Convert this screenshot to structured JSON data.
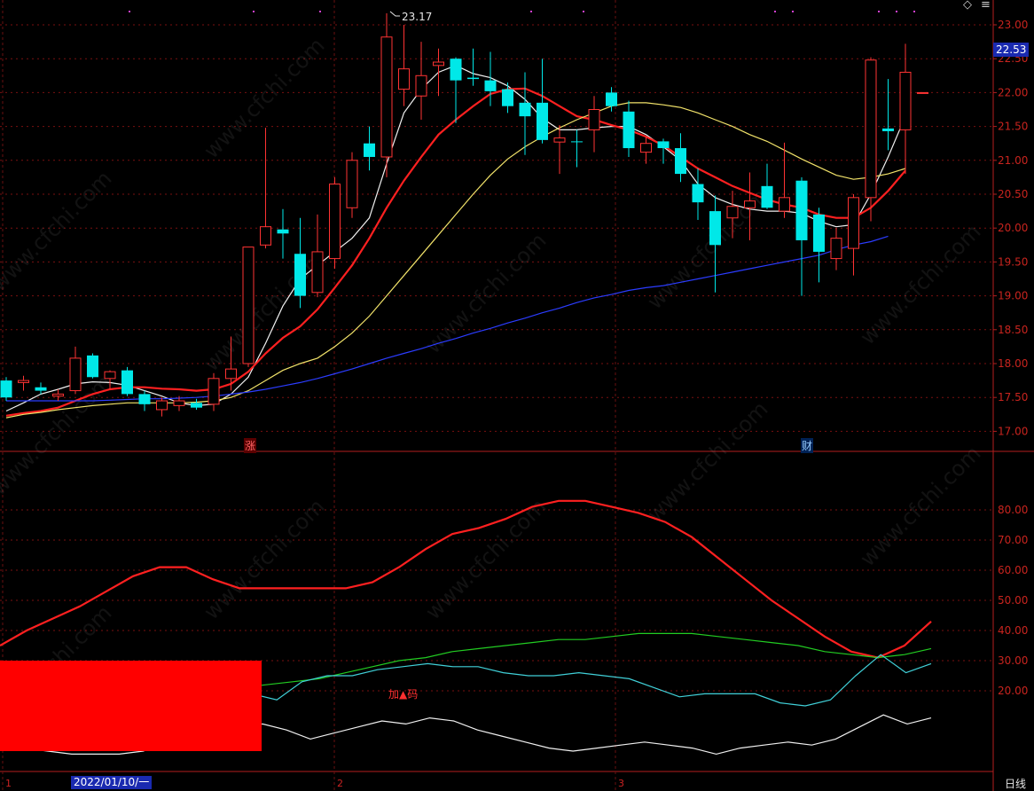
{
  "chart_data": [
    {
      "type": "candlestick",
      "period_label": "日线",
      "date_label": "2022/01/10/一",
      "month_labels": [
        "1",
        "2",
        "3"
      ],
      "price_badge": "22.53",
      "high_label": "23.17",
      "yticks": [
        17.0,
        17.5,
        18.0,
        18.5,
        19.0,
        19.5,
        20.0,
        20.5,
        21.0,
        21.5,
        22.0,
        22.5,
        23.0
      ],
      "ylim": [
        16.7,
        23.35
      ],
      "markers": [
        {
          "index": 14,
          "text": "涨"
        },
        {
          "index": 46,
          "text": "财"
        }
      ],
      "candles": [
        {
          "o": 17.75,
          "h": 17.8,
          "l": 17.45,
          "c": 17.5
        },
        {
          "o": 17.72,
          "h": 17.82,
          "l": 17.6,
          "c": 17.75
        },
        {
          "o": 17.65,
          "h": 17.72,
          "l": 17.55,
          "c": 17.6
        },
        {
          "o": 17.52,
          "h": 17.62,
          "l": 17.45,
          "c": 17.55
        },
        {
          "o": 17.6,
          "h": 18.25,
          "l": 17.55,
          "c": 18.08
        },
        {
          "o": 18.12,
          "h": 18.15,
          "l": 17.78,
          "c": 17.8
        },
        {
          "o": 17.78,
          "h": 17.9,
          "l": 17.62,
          "c": 17.88
        },
        {
          "o": 17.9,
          "h": 17.95,
          "l": 17.52,
          "c": 17.55
        },
        {
          "o": 17.55,
          "h": 17.6,
          "l": 17.3,
          "c": 17.4
        },
        {
          "o": 17.32,
          "h": 17.5,
          "l": 17.22,
          "c": 17.45
        },
        {
          "o": 17.38,
          "h": 17.52,
          "l": 17.3,
          "c": 17.45
        },
        {
          "o": 17.42,
          "h": 17.48,
          "l": 17.32,
          "c": 17.35
        },
        {
          "o": 17.4,
          "h": 17.86,
          "l": 17.3,
          "c": 17.78
        },
        {
          "o": 17.78,
          "h": 18.4,
          "l": 17.6,
          "c": 17.92
        },
        {
          "o": 18.0,
          "h": 18.55,
          "l": 17.95,
          "c": 19.72
        },
        {
          "o": 19.75,
          "h": 21.48,
          "l": 19.7,
          "c": 20.02
        },
        {
          "o": 19.98,
          "h": 20.28,
          "l": 19.55,
          "c": 19.92
        },
        {
          "o": 19.62,
          "h": 20.15,
          "l": 18.82,
          "c": 19.0
        },
        {
          "o": 19.05,
          "h": 20.2,
          "l": 18.98,
          "c": 19.65
        },
        {
          "o": 19.55,
          "h": 20.75,
          "l": 19.4,
          "c": 20.65
        },
        {
          "o": 20.3,
          "h": 21.12,
          "l": 20.15,
          "c": 21.0
        },
        {
          "o": 21.25,
          "h": 21.5,
          "l": 20.85,
          "c": 21.05
        },
        {
          "o": 21.05,
          "h": 23.17,
          "l": 20.75,
          "c": 22.82
        },
        {
          "o": 22.05,
          "h": 23.0,
          "l": 21.8,
          "c": 22.35
        },
        {
          "o": 21.95,
          "h": 22.75,
          "l": 21.6,
          "c": 22.25
        },
        {
          "o": 22.4,
          "h": 22.65,
          "l": 21.95,
          "c": 22.45
        },
        {
          "o": 22.5,
          "h": 22.52,
          "l": 21.55,
          "c": 22.18
        },
        {
          "o": 22.22,
          "h": 22.65,
          "l": 22.1,
          "c": 22.2
        },
        {
          "o": 22.18,
          "h": 22.6,
          "l": 21.8,
          "c": 22.02
        },
        {
          "o": 22.05,
          "h": 22.15,
          "l": 21.7,
          "c": 21.8
        },
        {
          "o": 21.85,
          "h": 22.3,
          "l": 21.08,
          "c": 21.65
        },
        {
          "o": 21.85,
          "h": 22.5,
          "l": 21.25,
          "c": 21.3
        },
        {
          "o": 21.27,
          "h": 21.52,
          "l": 20.8,
          "c": 21.33
        },
        {
          "o": 21.28,
          "h": 21.45,
          "l": 20.9,
          "c": 21.27
        },
        {
          "o": 21.45,
          "h": 21.95,
          "l": 21.12,
          "c": 21.75
        },
        {
          "o": 22.0,
          "h": 22.08,
          "l": 21.72,
          "c": 21.8
        },
        {
          "o": 21.72,
          "h": 21.88,
          "l": 21.05,
          "c": 21.18
        },
        {
          "o": 21.12,
          "h": 21.35,
          "l": 20.95,
          "c": 21.25
        },
        {
          "o": 21.28,
          "h": 21.32,
          "l": 20.95,
          "c": 21.18
        },
        {
          "o": 21.18,
          "h": 21.4,
          "l": 20.68,
          "c": 20.8
        },
        {
          "o": 20.65,
          "h": 20.88,
          "l": 20.12,
          "c": 20.38
        },
        {
          "o": 20.25,
          "h": 20.48,
          "l": 19.05,
          "c": 19.75
        },
        {
          "o": 20.15,
          "h": 20.55,
          "l": 19.85,
          "c": 20.32
        },
        {
          "o": 20.3,
          "h": 20.82,
          "l": 19.82,
          "c": 20.4
        },
        {
          "o": 20.62,
          "h": 20.95,
          "l": 20.28,
          "c": 20.3
        },
        {
          "o": 20.25,
          "h": 21.26,
          "l": 20.15,
          "c": 20.45
        },
        {
          "o": 20.7,
          "h": 20.75,
          "l": 19.0,
          "c": 19.82
        },
        {
          "o": 20.2,
          "h": 20.3,
          "l": 19.2,
          "c": 19.65
        },
        {
          "o": 19.55,
          "h": 20.0,
          "l": 19.38,
          "c": 19.85
        },
        {
          "o": 19.7,
          "h": 20.5,
          "l": 19.3,
          "c": 20.45
        },
        {
          "o": 20.45,
          "h": 22.52,
          "l": 20.1,
          "c": 22.48
        },
        {
          "o": 21.47,
          "h": 22.2,
          "l": 21.15,
          "c": 21.43
        },
        {
          "o": 21.45,
          "h": 22.72,
          "l": 20.8,
          "c": 22.3
        },
        {
          "o": 22.0,
          "h": 22.0,
          "l": 22.0,
          "c": 22.0
        }
      ],
      "ma_lines": [
        {
          "name": "ma-white",
          "color": "#f0f0f0",
          "values": [
            17.3,
            17.42,
            17.55,
            17.62,
            17.7,
            17.73,
            17.72,
            17.68,
            17.6,
            17.52,
            17.42,
            17.38,
            17.4,
            17.55,
            17.8,
            18.3,
            18.85,
            19.25,
            19.45,
            19.65,
            19.85,
            20.15,
            20.95,
            21.7,
            22.05,
            22.3,
            22.4,
            22.28,
            22.22,
            22.1,
            21.9,
            21.62,
            21.45,
            21.45,
            21.48,
            21.5,
            21.5,
            21.38,
            21.2,
            21.0,
            20.65,
            20.45,
            20.35,
            20.28,
            20.25,
            20.25,
            20.22,
            20.1,
            20.02,
            20.05,
            20.5,
            21.05,
            21.65
          ]
        },
        {
          "name": "ma-red",
          "color": "#ff2020",
          "values": [
            17.23,
            17.27,
            17.3,
            17.35,
            17.45,
            17.55,
            17.62,
            17.65,
            17.65,
            17.63,
            17.62,
            17.6,
            17.62,
            17.7,
            17.88,
            18.15,
            18.38,
            18.55,
            18.8,
            19.12,
            19.45,
            19.85,
            20.3,
            20.7,
            21.05,
            21.38,
            21.6,
            21.8,
            21.98,
            22.05,
            22.06,
            21.95,
            21.8,
            21.65,
            21.6,
            21.52,
            21.45,
            21.35,
            21.22,
            21.05,
            20.88,
            20.75,
            20.62,
            20.52,
            20.42,
            20.35,
            20.3,
            20.2,
            20.15,
            20.15,
            20.3,
            20.55,
            20.85
          ]
        },
        {
          "name": "ma-yellow",
          "color": "#f2e36a",
          "values": [
            17.2,
            17.25,
            17.28,
            17.32,
            17.35,
            17.38,
            17.4,
            17.42,
            17.42,
            17.42,
            17.42,
            17.43,
            17.45,
            17.5,
            17.6,
            17.75,
            17.9,
            18.0,
            18.08,
            18.25,
            18.45,
            18.7,
            19.0,
            19.3,
            19.6,
            19.9,
            20.2,
            20.5,
            20.78,
            21.02,
            21.2,
            21.35,
            21.48,
            21.6,
            21.7,
            21.8,
            21.85,
            21.85,
            21.82,
            21.78,
            21.7,
            21.6,
            21.5,
            21.38,
            21.28,
            21.15,
            21.02,
            20.9,
            20.78,
            20.72,
            20.75,
            20.8,
            20.88
          ]
        },
        {
          "name": "ma-blue",
          "color": "#2b3cff",
          "values": [
            17.45,
            17.45,
            17.45,
            17.45,
            17.45,
            17.45,
            17.46,
            17.47,
            17.48,
            17.48,
            17.49,
            17.5,
            17.52,
            17.55,
            17.58,
            17.62,
            17.67,
            17.72,
            17.78,
            17.85,
            17.92,
            18.0,
            18.08,
            18.15,
            18.22,
            18.3,
            18.37,
            18.45,
            18.52,
            18.6,
            18.67,
            18.75,
            18.82,
            18.9,
            18.97,
            19.02,
            19.08,
            19.12,
            19.15,
            19.2,
            19.25,
            19.3,
            19.35,
            19.4,
            19.45,
            19.5,
            19.55,
            19.6,
            19.68,
            19.75,
            19.8,
            19.88
          ]
        }
      ]
    },
    {
      "type": "line",
      "yticks": [
        20.0,
        30.0,
        40.0,
        50.0,
        60.0,
        70.0,
        80.0
      ],
      "ylim": [
        0,
        92
      ],
      "annotation": "加▲码",
      "series": [
        {
          "color": "#ff2020",
          "values": [
            35,
            40,
            44,
            48,
            53,
            58,
            61,
            61,
            57,
            54,
            54,
            54,
            54,
            54,
            56,
            61,
            67,
            72,
            74,
            77,
            81,
            83,
            83,
            81,
            79,
            76,
            71,
            64,
            57,
            50,
            44,
            38,
            33,
            31,
            35,
            43
          ]
        },
        {
          "color": "#22cc22",
          "values": [
            12,
            15,
            16,
            18,
            19,
            19,
            19,
            19,
            20,
            21,
            22,
            23,
            24,
            26,
            28,
            30,
            31,
            33,
            34,
            35,
            36,
            37,
            37,
            38,
            39,
            39,
            39,
            38,
            37,
            36,
            35,
            33,
            32,
            31,
            32,
            34
          ]
        },
        {
          "color": "#40d0d8",
          "values": [
            15,
            17,
            18,
            21,
            22,
            19,
            16,
            14,
            13,
            16,
            19,
            17,
            23,
            25,
            25,
            27,
            28,
            29,
            28,
            28,
            26,
            25,
            25,
            26,
            25,
            24,
            21,
            18,
            19,
            19,
            19,
            16,
            15,
            17,
            25,
            32,
            26,
            29
          ]
        },
        {
          "color": "#f0f0f0",
          "values": [
            2,
            1,
            0,
            -1,
            -1,
            -1,
            0,
            3,
            5,
            7,
            8,
            9,
            7,
            4,
            6,
            8,
            10,
            9,
            11,
            10,
            7,
            5,
            3,
            1,
            0,
            1,
            2,
            3,
            2,
            1,
            -1,
            1,
            2,
            3,
            2,
            4,
            8,
            12,
            9,
            11
          ]
        }
      ]
    }
  ],
  "watermark": "www.cfchi.com"
}
